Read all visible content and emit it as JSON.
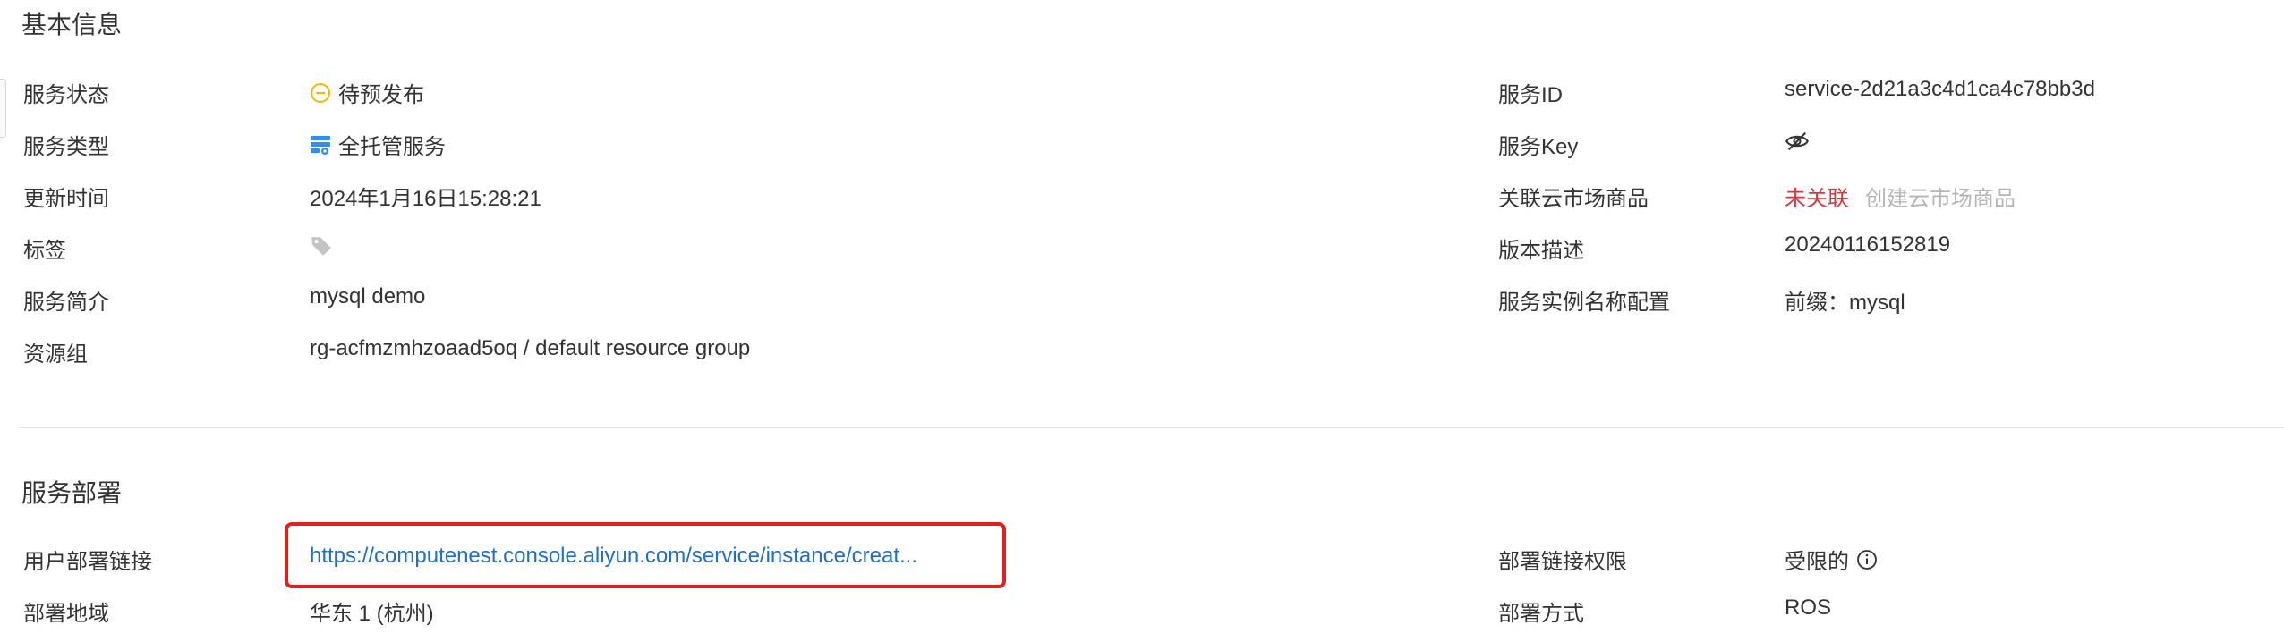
{
  "basic_info": {
    "title": "基本信息",
    "left": [
      {
        "label": "服务状态",
        "value": "待预发布",
        "icon": "pending-status-icon"
      },
      {
        "label": "服务类型",
        "value": "全托管服务",
        "icon": "managed-service-icon"
      },
      {
        "label": "更新时间",
        "value": "2024年1月16日15:28:21"
      },
      {
        "label": "标签",
        "value": "",
        "icon": "tag-icon"
      },
      {
        "label": "服务简介",
        "value": "mysql demo"
      },
      {
        "label": "资源组",
        "value": "rg-acfmzmhzoaad5oq / default resource group"
      }
    ],
    "right": [
      {
        "label": "服务ID",
        "value": "service-2d21a3c4d1ca4c78bb3d"
      },
      {
        "label": "服务Key",
        "value": "",
        "icon": "eye-hidden-icon"
      },
      {
        "label": "关联云市场商品",
        "value": "未关联",
        "action": "创建云市场商品"
      },
      {
        "label": "版本描述",
        "value": "20240116152819"
      },
      {
        "label": "服务实例名称配置",
        "value": "前缀：mysql"
      }
    ]
  },
  "deployment": {
    "title": "服务部署",
    "left": [
      {
        "label": "用户部署链接",
        "value": "https://computenest.console.aliyun.com/service/instance/creat..."
      },
      {
        "label": "部署地域",
        "value": "华东 1 (杭州)"
      }
    ],
    "right": [
      {
        "label": "部署链接权限",
        "value": "受限的",
        "icon": "info-icon"
      },
      {
        "label": "部署方式",
        "value": "ROS"
      }
    ]
  },
  "colors": {
    "link": "#1f6fc7",
    "unlinked": "#d9363e",
    "disabled_action": "#b5b5b5",
    "highlight_border": "#e0201f",
    "pending_icon": "#f5b800",
    "service_icon": "#2f8ef0"
  }
}
